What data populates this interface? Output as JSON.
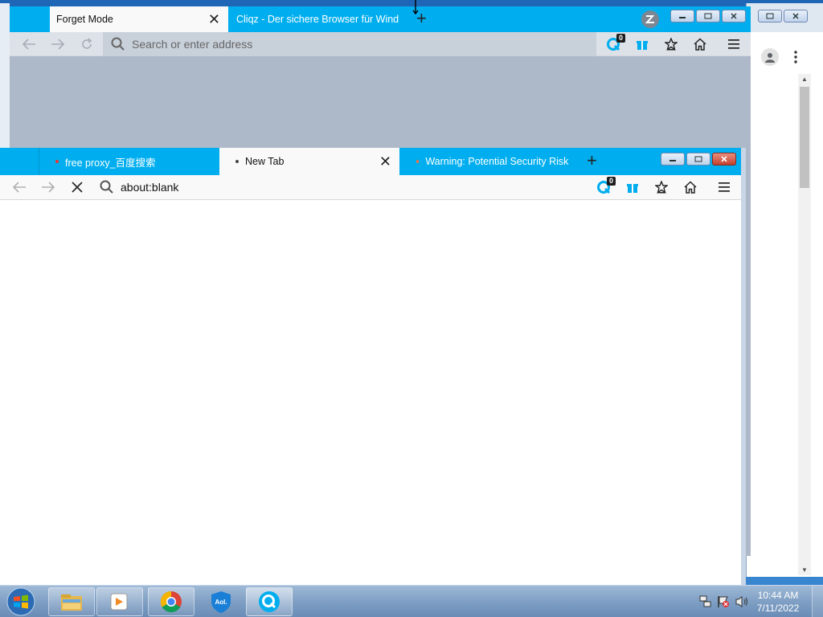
{
  "back_window": {
    "tabs": [
      {
        "label": "Forget Mode",
        "active": true
      },
      {
        "label": "Cliqz - Der sichere Browser für Windows",
        "active": false
      }
    ],
    "urlbar_placeholder": "Search or enter address",
    "badge_count": "0"
  },
  "front_window": {
    "tabs": [
      {
        "label": "free proxy_百度搜索",
        "active": false
      },
      {
        "label": "New Tab",
        "active": true
      },
      {
        "label": "Warning: Potential Security Risk Ahead",
        "active": false
      }
    ],
    "url": "about:blank",
    "badge_count": "0"
  },
  "taskbar": {
    "apps": [
      "explorer-icon",
      "media-player-icon",
      "chrome-icon",
      "aol-shield-icon",
      "cliqz-icon"
    ],
    "time": "10:44 AM",
    "date": "7/11/2022"
  },
  "colors": {
    "titlebar": "#00aeef",
    "toolbar": "#f9f9fa",
    "back_content": "#adb9c8"
  }
}
